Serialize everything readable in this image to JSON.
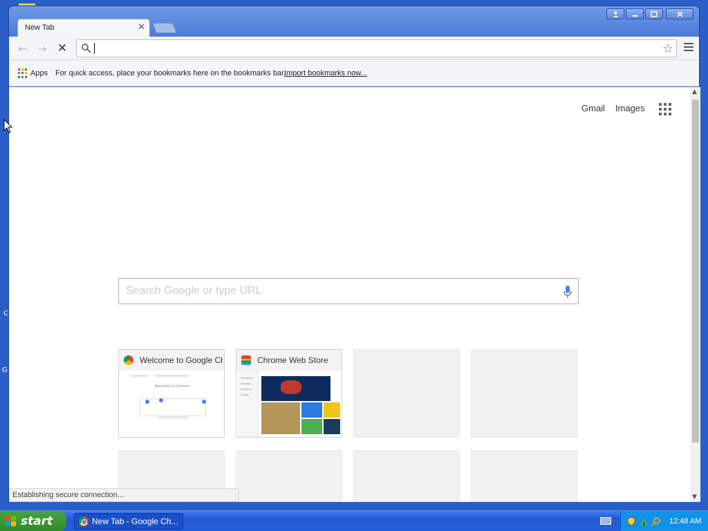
{
  "desktop": {
    "fragments": [
      "C",
      "G"
    ]
  },
  "window": {
    "tab_title": "New Tab",
    "omnibox_value": "",
    "bookmarks": {
      "apps_label": "Apps",
      "hint": "For quick access, place your bookmarks here on the bookmarks bar.",
      "import_link": "Import bookmarks now..."
    },
    "page": {
      "gmail": "Gmail",
      "images": "Images",
      "search_placeholder": "Search Google or type URL",
      "tiles": [
        {
          "title": "Welcome to Google Chrome",
          "thumb_heading": "Welcome to Chrome"
        },
        {
          "title": "Chrome Web Store"
        }
      ],
      "status": "Establishing secure connection..."
    }
  },
  "taskbar": {
    "start_label": "start",
    "task_label": "New Tab - Google Ch...",
    "clock": "12:48 AM"
  },
  "colors": {
    "google_blue": "#4285f4",
    "google_red": "#db4437",
    "google_yellow": "#f4b400",
    "google_green": "#0f9d58"
  }
}
